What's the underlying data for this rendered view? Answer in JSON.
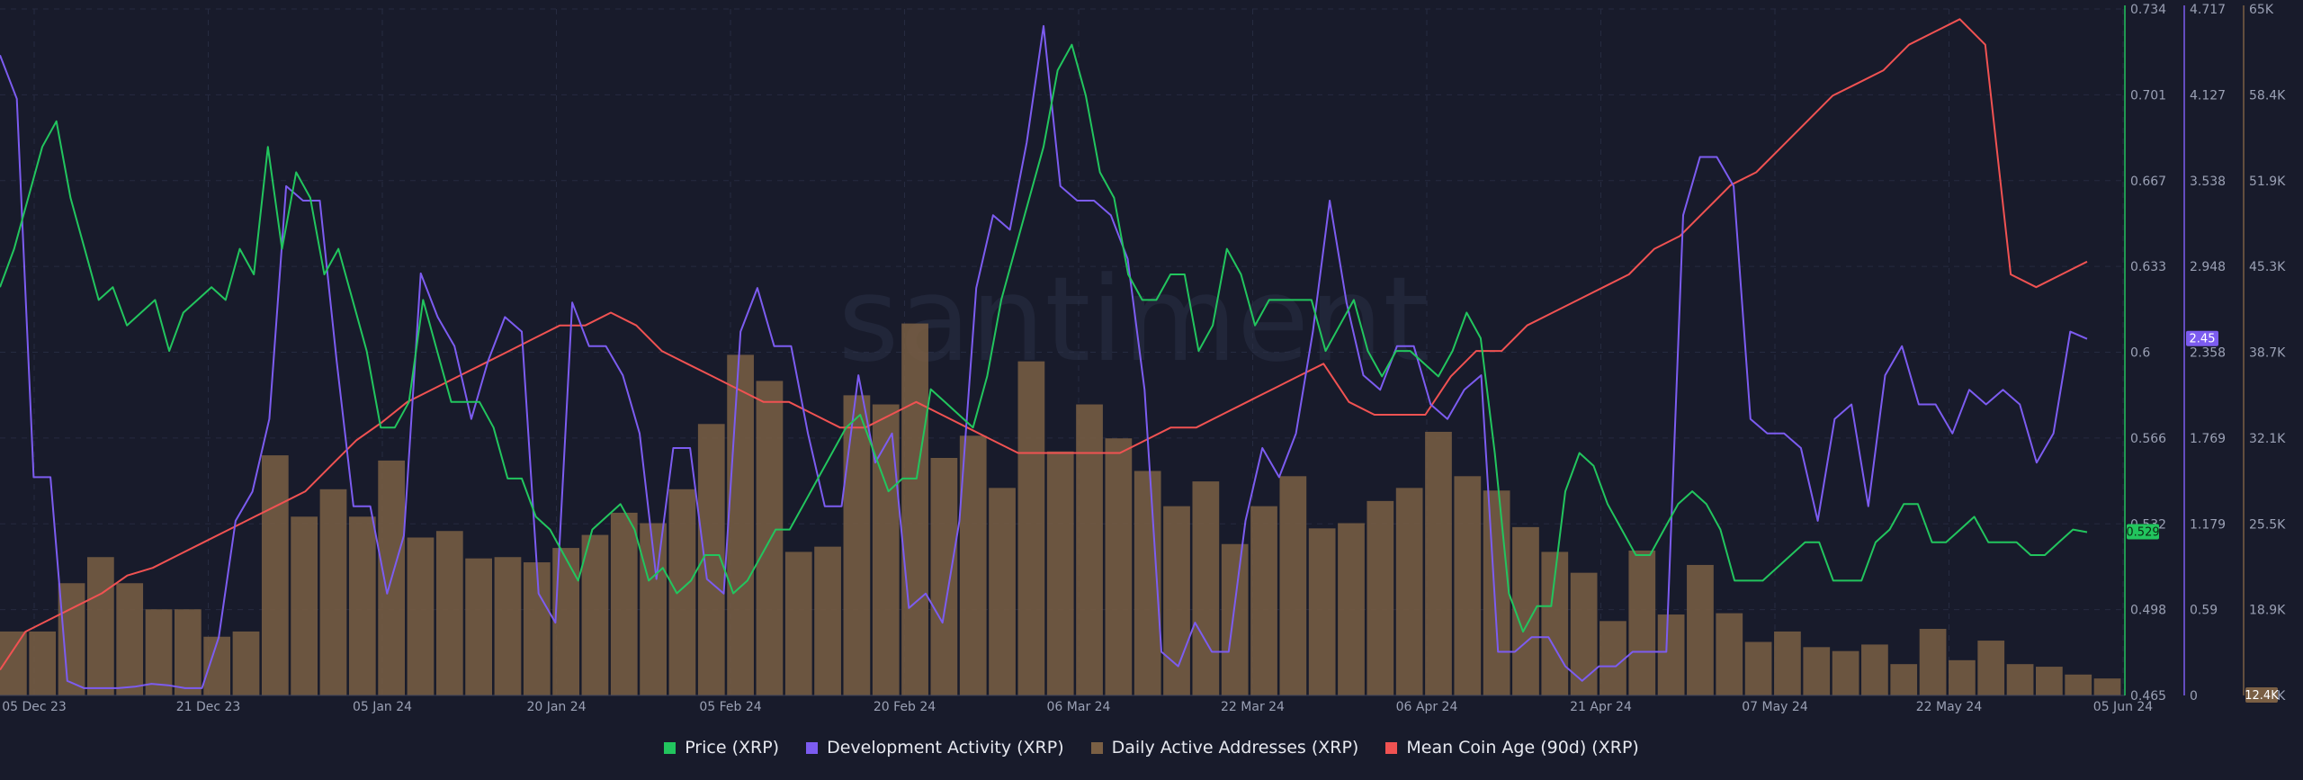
{
  "chart_data": {
    "type": "line",
    "watermark": "santiment",
    "x_ticks": [
      "05 Dec 23",
      "21 Dec 23",
      "05 Jan 24",
      "20 Jan 24",
      "05 Feb 24",
      "20 Feb 24",
      "06 Mar 24",
      "22 Mar 24",
      "06 Apr 24",
      "21 Apr 24",
      "07 May 24",
      "22 May 24",
      "05 Jun 24"
    ],
    "axes": {
      "price": {
        "ticks": [
          "0.734",
          "0.701",
          "0.667",
          "0.633",
          "0.6",
          "0.566",
          "0.532",
          "0.498",
          "0.465"
        ],
        "min": 0.465,
        "max": 0.734,
        "color": "#22c55e",
        "current": "0.529",
        "current_value": 0.529
      },
      "dev": {
        "ticks": [
          "4.717",
          "4.127",
          "3.538",
          "2.948",
          "2.358",
          "1.769",
          "1.179",
          "0.59",
          "0"
        ],
        "min": 0,
        "max": 4.717,
        "color": "#7c5cf0",
        "current": "2.45",
        "current_value": 2.45
      },
      "daa": {
        "ticks": [
          "65K",
          "58.4K",
          "51.9K",
          "45.3K",
          "38.7K",
          "32.1K",
          "25.5K",
          "18.9K",
          "12.4K"
        ],
        "min": 12400,
        "max": 65000,
        "color": "#7a5f44",
        "current": "12.4K"
      }
    },
    "legend": [
      "Price (XRP)",
      "Development Activity (XRP)",
      "Daily Active Addresses (XRP)",
      "Mean Coin Age (90d) (XRP)"
    ],
    "series": [
      {
        "name": "Price (XRP)",
        "color": "#22c55e",
        "axis": "price",
        "values": [
          0.625,
          0.64,
          0.66,
          0.68,
          0.69,
          0.66,
          0.64,
          0.62,
          0.625,
          0.61,
          0.615,
          0.62,
          0.6,
          0.615,
          0.62,
          0.625,
          0.62,
          0.64,
          0.63,
          0.68,
          0.64,
          0.67,
          0.66,
          0.63,
          0.64,
          0.62,
          0.6,
          0.57,
          0.57,
          0.58,
          0.62,
          0.6,
          0.58,
          0.58,
          0.58,
          0.57,
          0.55,
          0.55,
          0.535,
          0.53,
          0.52,
          0.51,
          0.53,
          0.535,
          0.54,
          0.53,
          0.51,
          0.515,
          0.505,
          0.51,
          0.52,
          0.52,
          0.505,
          0.51,
          0.52,
          0.53,
          0.53,
          0.54,
          0.55,
          0.56,
          0.57,
          0.575,
          0.56,
          0.545,
          0.55,
          0.55,
          0.585,
          0.58,
          0.575,
          0.57,
          0.59,
          0.62,
          0.64,
          0.66,
          0.68,
          0.71,
          0.72,
          0.7,
          0.67,
          0.66,
          0.63,
          0.62,
          0.62,
          0.63,
          0.63,
          0.6,
          0.61,
          0.64,
          0.63,
          0.61,
          0.62,
          0.62,
          0.62,
          0.62,
          0.6,
          0.61,
          0.62,
          0.6,
          0.59,
          0.6,
          0.6,
          0.595,
          0.59,
          0.6,
          0.615,
          0.605,
          0.56,
          0.505,
          0.49,
          0.5,
          0.5,
          0.545,
          0.56,
          0.555,
          0.54,
          0.53,
          0.52,
          0.52,
          0.53,
          0.54,
          0.545,
          0.54,
          0.53,
          0.51,
          0.51,
          0.51,
          0.515,
          0.52,
          0.525,
          0.525,
          0.51,
          0.51,
          0.51,
          0.525,
          0.53,
          0.54,
          0.54,
          0.525,
          0.525,
          0.53,
          0.535,
          0.525,
          0.525,
          0.525,
          0.52,
          0.52,
          0.525,
          0.53,
          0.529
        ]
      },
      {
        "name": "Development Activity (XRP)",
        "color": "#7c5cf0",
        "axis": "dev",
        "values": [
          4.4,
          4.1,
          1.5,
          1.5,
          0.1,
          0.05,
          0.05,
          0.05,
          0.06,
          0.08,
          0.07,
          0.05,
          0.05,
          0.4,
          1.2,
          1.4,
          1.9,
          3.5,
          3.4,
          3.4,
          2.3,
          1.3,
          1.3,
          0.7,
          1.1,
          2.9,
          2.6,
          2.4,
          1.9,
          2.3,
          2.6,
          2.5,
          0.7,
          0.5,
          2.7,
          2.4,
          2.4,
          2.2,
          1.8,
          0.8,
          1.7,
          1.7,
          0.8,
          0.7,
          2.5,
          2.8,
          2.4,
          2.4,
          1.8,
          1.3,
          1.3,
          2.2,
          1.6,
          1.8,
          0.6,
          0.7,
          0.5,
          1.2,
          2.8,
          3.3,
          3.2,
          3.8,
          4.6,
          3.5,
          3.4,
          3.4,
          3.3,
          3.0,
          2.1,
          0.3,
          0.2,
          0.5,
          0.3,
          0.3,
          1.2,
          1.7,
          1.5,
          1.8,
          2.5,
          3.4,
          2.7,
          2.2,
          2.1,
          2.4,
          2.4,
          2.0,
          1.9,
          2.1,
          2.2,
          0.3,
          0.3,
          0.4,
          0.4,
          0.2,
          0.1,
          0.2,
          0.2,
          0.3,
          0.3,
          0.3,
          3.3,
          3.7,
          3.7,
          3.5,
          1.9,
          1.8,
          1.8,
          1.7,
          1.2,
          1.9,
          2.0,
          1.3,
          2.2,
          2.4,
          2.0,
          2.0,
          1.8,
          2.1,
          2.0,
          2.1,
          2.0,
          1.6,
          1.8,
          2.5,
          2.45
        ]
      },
      {
        "name": "Daily Active Addresses (XRP)",
        "color": "#7a5f44",
        "axis": "daa",
        "values": [
          17300,
          17300,
          21000,
          23000,
          21000,
          19000,
          19000,
          16900,
          17300,
          30800,
          26100,
          28200,
          26100,
          30400,
          24500,
          25000,
          22900,
          23000,
          22600,
          23700,
          24700,
          26400,
          25600,
          28200,
          33200,
          38500,
          36500,
          23400,
          23800,
          35400,
          34700,
          40900,
          30600,
          32300,
          28300,
          38000,
          31100,
          34700,
          32100,
          29600,
          26900,
          28800,
          24000,
          26900,
          29200,
          25200,
          25600,
          27300,
          28300,
          32600,
          29200,
          28100,
          25300,
          23400,
          21800,
          18100,
          23500,
          18600,
          22400,
          18700,
          16500,
          17300,
          16100,
          15800,
          16300,
          14800,
          17500,
          15100,
          16600,
          14800,
          14600,
          14000,
          13700
        ]
      },
      {
        "name": "Mean Coin Age (90d) (XRP)",
        "color": "#f05252",
        "axis": "price",
        "values": [
          0.475,
          0.49,
          0.495,
          0.5,
          0.505,
          0.512,
          0.515,
          0.52,
          0.525,
          0.53,
          0.535,
          0.54,
          0.545,
          0.555,
          0.565,
          0.572,
          0.58,
          0.585,
          0.59,
          0.595,
          0.6,
          0.605,
          0.61,
          0.61,
          0.615,
          0.61,
          0.6,
          0.595,
          0.59,
          0.585,
          0.58,
          0.58,
          0.575,
          0.57,
          0.57,
          0.575,
          0.58,
          0.575,
          0.57,
          0.565,
          0.56,
          0.56,
          0.56,
          0.56,
          0.56,
          0.565,
          0.57,
          0.57,
          0.575,
          0.58,
          0.585,
          0.59,
          0.595,
          0.58,
          0.575,
          0.575,
          0.575,
          0.59,
          0.6,
          0.6,
          0.61,
          0.615,
          0.62,
          0.625,
          0.63,
          0.64,
          0.645,
          0.655,
          0.665,
          0.67,
          0.68,
          0.69,
          0.7,
          0.705,
          0.71,
          0.72,
          0.725,
          0.73,
          0.72,
          0.63,
          0.625,
          0.63,
          0.635
        ]
      }
    ]
  }
}
